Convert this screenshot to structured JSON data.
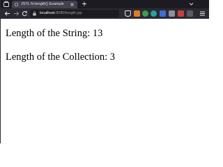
{
  "tab": {
    "title": "JSTL fn:length() Example"
  },
  "address_bar": {
    "host": "localhost",
    "path": ":8080/length.jsp"
  },
  "page": {
    "lines": [
      "Length of the String: 13",
      "Length of the Collection: 3"
    ]
  },
  "colors": {
    "tabstrip_bg": "#1c1b22",
    "toolbar_bg": "#2b2a33",
    "active_tab_bg": "#42414d",
    "page_bg": "#ffffff",
    "page_text": "#000000"
  },
  "icons": {
    "tab_list": "tab-list-icon",
    "favicon": "page-favicon-icon",
    "tab_close": "close-icon",
    "new_tab": "plus-icon",
    "tab_overflow": "chevron-down-icon",
    "back": "back-arrow-icon",
    "forward": "forward-arrow-icon",
    "reload": "reload-icon",
    "lock": "lock-icon",
    "toolbar_extensions": [
      "pocket-icon",
      "extension-orange-icon",
      "extension-green-icon",
      "extension-teal-icon",
      "extension-blue-icon",
      "extension-gray-icon",
      "extension-red-icon",
      "extension-dark-icon",
      "menu-icon"
    ]
  }
}
